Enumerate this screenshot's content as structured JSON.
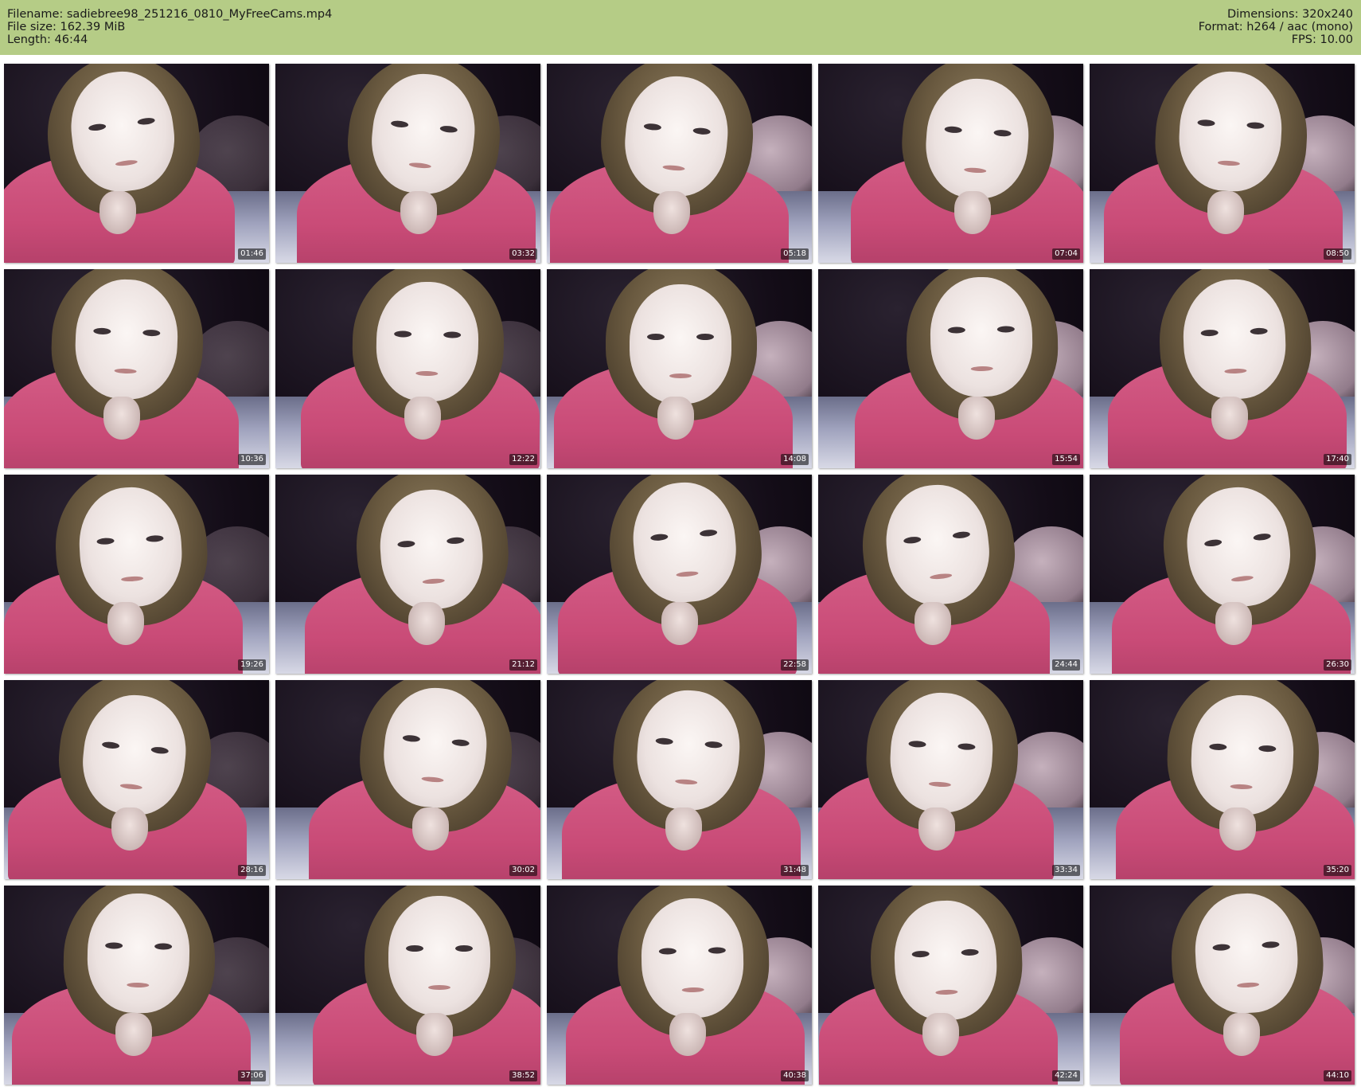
{
  "header": {
    "filename_line": "Filename: sadiebree98_251216_0810_MyFreeCams.mp4",
    "filesize_line": "File size: 162.39 MiB",
    "length_line": "Length: 46:44",
    "dimensions_line": "Dimensions: 320x240",
    "format_line": "Format: h264 / aac (mono)",
    "fps_line": "FPS: 10.00",
    "background_color": "#b5cc86"
  },
  "thumbnails": [
    {
      "timestamp": "01:46"
    },
    {
      "timestamp": "03:32"
    },
    {
      "timestamp": "05:18"
    },
    {
      "timestamp": "07:04"
    },
    {
      "timestamp": "08:50"
    },
    {
      "timestamp": "10:36"
    },
    {
      "timestamp": "12:22"
    },
    {
      "timestamp": "14:08"
    },
    {
      "timestamp": "15:54"
    },
    {
      "timestamp": "17:40"
    },
    {
      "timestamp": "19:26"
    },
    {
      "timestamp": "21:12"
    },
    {
      "timestamp": "22:58"
    },
    {
      "timestamp": "24:44"
    },
    {
      "timestamp": "26:30"
    },
    {
      "timestamp": "28:16"
    },
    {
      "timestamp": "30:02"
    },
    {
      "timestamp": "31:48"
    },
    {
      "timestamp": "33:34"
    },
    {
      "timestamp": "35:20"
    },
    {
      "timestamp": "37:06"
    },
    {
      "timestamp": "38:52"
    },
    {
      "timestamp": "40:38"
    },
    {
      "timestamp": "42:24"
    },
    {
      "timestamp": "44:10"
    }
  ]
}
